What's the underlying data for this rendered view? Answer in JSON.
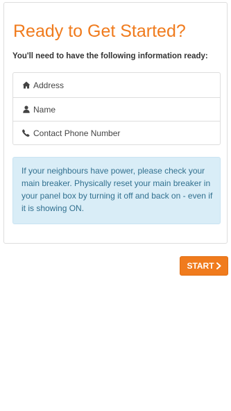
{
  "page": {
    "title": "Ready to Get Started?",
    "subtitle": "You'll need to have the following information ready:"
  },
  "info_items": [
    {
      "icon": "home-icon",
      "label": "Address"
    },
    {
      "icon": "user-icon",
      "label": "Name"
    },
    {
      "icon": "phone-icon",
      "label": "Contact Phone Number"
    }
  ],
  "notice": {
    "text": "If your neighbours have power, please check your main breaker. Physically reset your main breaker in your panel box by turning it off and back on - even if it is showing ON."
  },
  "actions": {
    "start_label": "START"
  },
  "colors": {
    "accent": "#f07b1d",
    "notice_bg": "#d9edf7",
    "notice_text": "#31708f"
  }
}
